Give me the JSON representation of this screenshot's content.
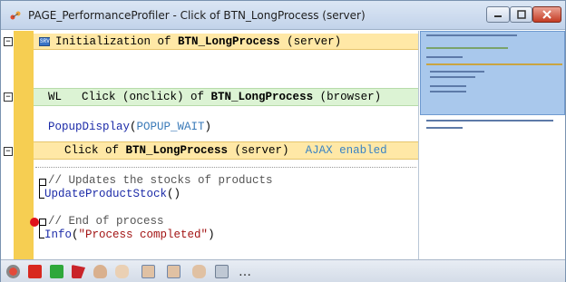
{
  "window": {
    "title": "PAGE_PerformanceProfiler - Click of BTN_LongProcess (server)",
    "minimize_label": "–",
    "maximize_label": "□",
    "close_label": "✕"
  },
  "editor": {
    "block1": {
      "badge": "SRV",
      "prefix": "Initialization of ",
      "name": "BTN_LongProcess",
      "suffix": " (server)"
    },
    "block2": {
      "tag": "WL",
      "prefix": "Click (onclick) of ",
      "name": "BTN_LongProcess",
      "suffix": " (browser)"
    },
    "line_popup": {
      "fn": "PopupDisplay",
      "open": "(",
      "arg": "POPUP_WAIT",
      "close": ")"
    },
    "block3": {
      "prefix": "Click of ",
      "name": "BTN_LongProcess",
      "suffix": " (server)",
      "ajax": "AJAX enabled"
    },
    "comment1": "// Updates the stocks of products",
    "line_update": {
      "fn": "UpdateProductStock",
      "args": "()"
    },
    "comment2": "// End of process",
    "line_info": {
      "fn": "Info",
      "open": "(",
      "arg": "\"Process completed\"",
      "close": ")"
    }
  },
  "toolbar": {
    "more_label": "…",
    "icons": [
      "stop-icon",
      "red-square-icon",
      "green-square-icon",
      "red-flag-icon",
      "hand-cursor-icon",
      "hand-icon",
      "hand-pointer-icon",
      "hand-select-icon",
      "hand-grab-icon",
      "eye-view-icon"
    ]
  },
  "colors": {
    "block_server": "#ffe8a6",
    "block_browser": "#dcf3d4",
    "bar": "#f6ce52",
    "breakpoint": "#e0121a"
  }
}
